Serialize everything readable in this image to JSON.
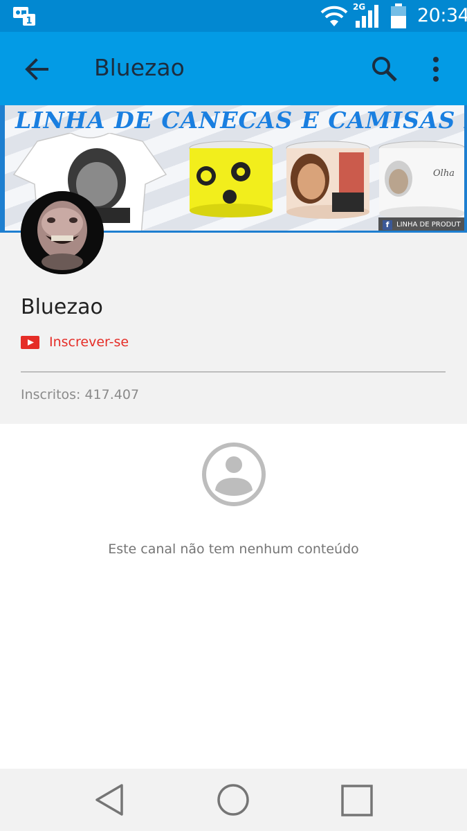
{
  "status_bar": {
    "time": "20:34",
    "network": "2G",
    "icons": [
      "notification-icon",
      "wifi-icon",
      "signal-icon",
      "battery-icon"
    ]
  },
  "app_bar": {
    "title": "Bluezao",
    "icons": [
      "back-arrow-icon",
      "search-icon",
      "more-vert-icon"
    ],
    "color": "#039be5"
  },
  "banner": {
    "headline": "LINHA DE CANECAS E CAMISAS DO BLU",
    "fb_tag": "LINHA DE PRODUT",
    "fb_mark": "f"
  },
  "channel": {
    "name": "Bluezao",
    "subscribe_label": "Inscrever-se",
    "subscribers_text": "Inscritos: 417.407",
    "accent_color": "#e52d27"
  },
  "empty_state": {
    "icon": "account-circle-icon",
    "message": "Este canal não tem nenhum conteúdo"
  },
  "nav_bar": {
    "icons": [
      "nav-back-icon",
      "nav-home-icon",
      "nav-recents-icon"
    ]
  }
}
